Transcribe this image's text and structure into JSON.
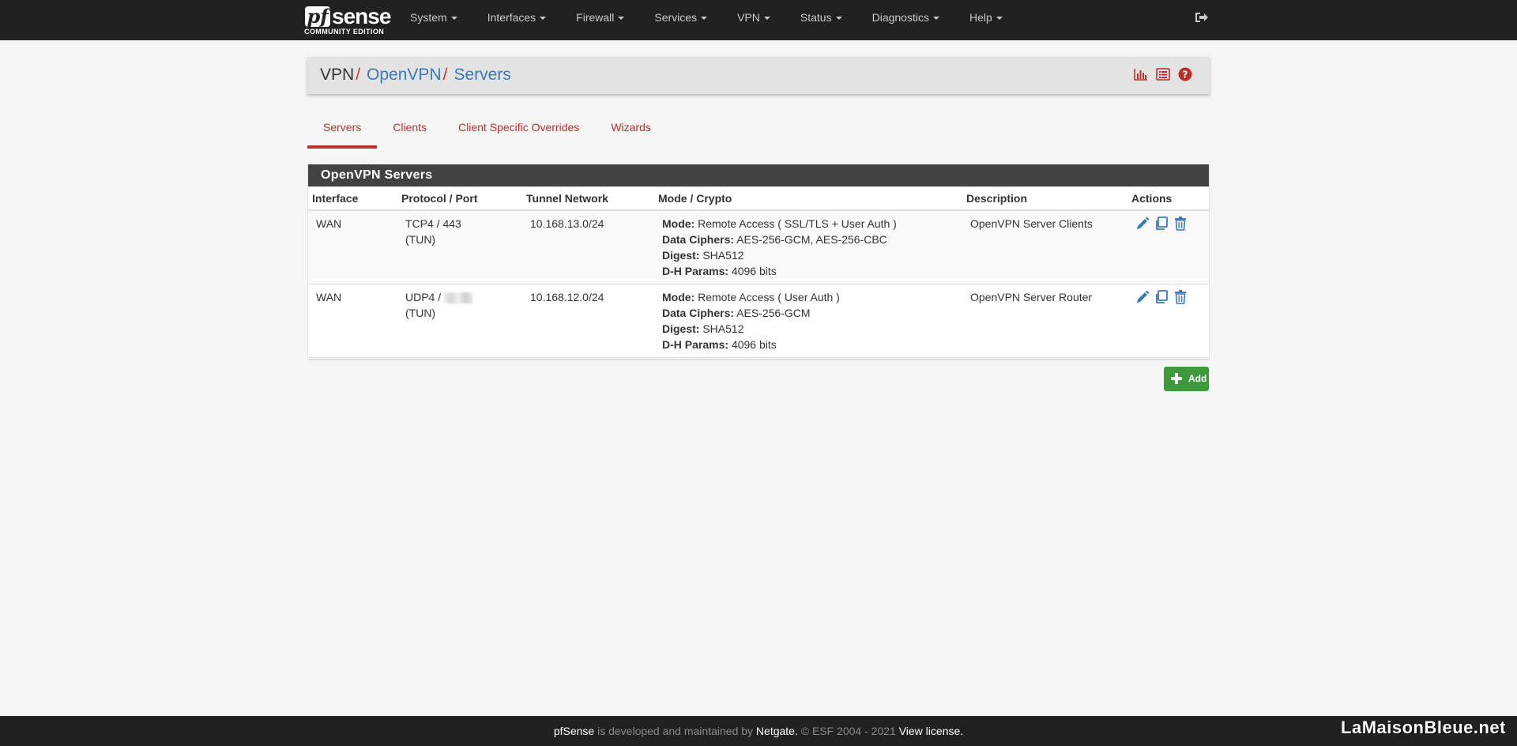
{
  "brand": {
    "logo_text_pf": "pf",
    "logo_text_sense": "sense",
    "edition": "COMMUNITY EDITION"
  },
  "nav": {
    "items": [
      {
        "label": "System"
      },
      {
        "label": "Interfaces"
      },
      {
        "label": "Firewall"
      },
      {
        "label": "Services"
      },
      {
        "label": "VPN"
      },
      {
        "label": "Status"
      },
      {
        "label": "Diagnostics"
      },
      {
        "label": "Help"
      }
    ],
    "logout_icon": "sign-out-icon"
  },
  "breadcrumb": {
    "root": "VPN",
    "sep": "/",
    "level1": "OpenVPN",
    "level2": "Servers"
  },
  "header_icons": [
    "bar-chart-icon",
    "list-icon",
    "question-circle-icon"
  ],
  "tabs": [
    {
      "label": "Servers",
      "active": true
    },
    {
      "label": "Clients"
    },
    {
      "label": "Client Specific Overrides"
    },
    {
      "label": "Wizards"
    }
  ],
  "panel": {
    "title": "OpenVPN Servers",
    "columns": [
      "Interface",
      "Protocol / Port",
      "Tunnel Network",
      "Mode / Crypto",
      "Description",
      "Actions"
    ],
    "rows": [
      {
        "interface": "WAN",
        "protocol_port": "TCP4 / 443",
        "tun": "(TUN)",
        "tunnel_network": "10.168.13.0/24",
        "mode_label": "Mode:",
        "mode": "Remote Access ( SSL/TLS + User Auth )",
        "ciphers_label": "Data Ciphers:",
        "ciphers": "AES-256-GCM, AES-256-CBC",
        "digest_label": "Digest:",
        "digest": "SHA512",
        "dh_label": "D-H Params:",
        "dh": "4096 bits",
        "description": "OpenVPN Server Clients"
      },
      {
        "interface": "WAN",
        "protocol_port": "UDP4 /",
        "tun": "(TUN)",
        "tunnel_network": "10.168.12.0/24",
        "mode_label": "Mode:",
        "mode": "Remote Access ( User Auth )",
        "ciphers_label": "Data Ciphers:",
        "ciphers": "AES-256-GCM",
        "digest_label": "Digest:",
        "digest": "SHA512",
        "dh_label": "D-H Params:",
        "dh": "4096 bits",
        "description": "OpenVPN Server Router"
      }
    ],
    "action_icons": [
      "pencil-icon",
      "clone-icon",
      "trash-icon"
    ]
  },
  "add_button": {
    "label": "Add",
    "icon": "plus-icon"
  },
  "footer": {
    "brand": "pfSense",
    "text1": " is developed and maintained by ",
    "company": "Netgate.",
    "text2": " © ESF 2004 - 2021 ",
    "license": "View license."
  },
  "watermark": "LaMaisonBleue.net",
  "colors": {
    "navbar": "#212121",
    "accent_red": "#b7312c",
    "link_blue": "#3a7ab9",
    "add_green": "#3c9a3c"
  }
}
